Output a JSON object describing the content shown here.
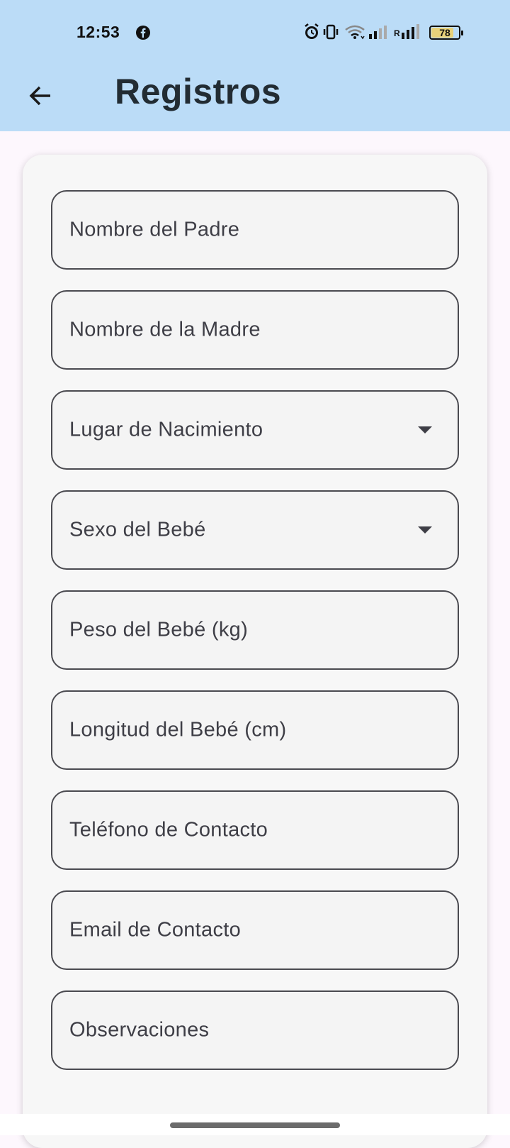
{
  "status_bar": {
    "time": "12:53",
    "battery": "78",
    "icons": [
      "facebook-icon",
      "alarm-icon",
      "vibrate-icon",
      "wifi-icon",
      "signal-icon",
      "signal-roaming-icon",
      "battery-icon"
    ],
    "roaming_label": "R"
  },
  "app_bar": {
    "title": "Registros",
    "back_icon": "arrow-left-icon",
    "background": "#bbdcf7"
  },
  "form": {
    "fields": [
      {
        "label": "Nombre del Padre",
        "type": "text"
      },
      {
        "label": "Nombre de la Madre",
        "type": "text"
      },
      {
        "label": "Lugar de Nacimiento",
        "type": "dropdown"
      },
      {
        "label": "Sexo del Bebé",
        "type": "dropdown"
      },
      {
        "label": "Peso del Bebé (kg)",
        "type": "text"
      },
      {
        "label": "Longitud del Bebé (cm)",
        "type": "text"
      },
      {
        "label": "Teléfono de Contacto",
        "type": "text"
      },
      {
        "label": "Email de Contacto",
        "type": "text"
      },
      {
        "label": "Observaciones",
        "type": "text"
      }
    ]
  },
  "colors": {
    "accent": "#bbdcf7",
    "field_border": "#4a4a50",
    "text": "#3e3e46",
    "title": "#222c33"
  }
}
